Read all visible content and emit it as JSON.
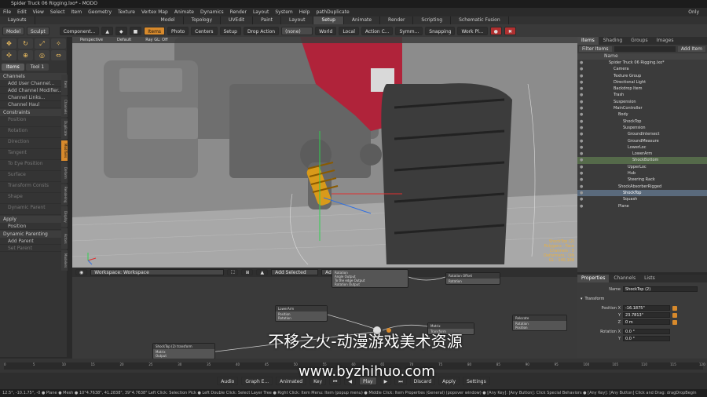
{
  "window": {
    "title": "Spider Truck 06 Rigging.lxo* - MODO"
  },
  "menu": [
    "File",
    "Edit",
    "View",
    "Select",
    "Item",
    "Geometry",
    "Texture",
    "Vertex Map",
    "Animate",
    "Dynamics",
    "Render",
    "Layout",
    "System",
    "Help",
    "pathDuplicate"
  ],
  "menu_right": "Only",
  "layouts": {
    "label": "Layouts",
    "tabs": [
      "Model",
      "Topology",
      "UVEdit",
      "Paint",
      "Layout",
      "Setup",
      "Animate",
      "Render",
      "Scripting",
      "Schematic Fusion"
    ],
    "active": "Setup"
  },
  "toolbar": {
    "items": [
      "Model",
      "Sculpt",
      "Component...",
      "Items",
      "Photo",
      "Centers",
      "Setup",
      "Drop Action",
      "(none)",
      "World",
      "Local",
      "Action C...",
      "Symm...",
      "Snapping",
      "Work Pl..."
    ]
  },
  "left": {
    "tabs": [
      "Items",
      "Tool 1"
    ],
    "channels_header": "Channels",
    "channel_items": [
      "Add User Channel...",
      "Add Channel Modifier...",
      "Channel Links...",
      "Channel Haul"
    ],
    "constraints_header": "Constraints",
    "constraint_items": [
      "Position",
      "Rotation",
      "Direction",
      "Tangent",
      "To Eye Position",
      "Surface",
      "Transform Consts",
      "Shape",
      "Dynamic Parent"
    ],
    "apply_label": "Apply",
    "position_label": "Position",
    "dynamic_header": "Dynamic Parenting",
    "add_parent": "Add Parent",
    "set_parent": "Set Parent",
    "vtabs": [
      "Item",
      "Channels",
      "Duplicate",
      "Modifiers",
      "Deform",
      "Rendering",
      "Display",
      "Actors",
      "Modelers"
    ]
  },
  "viewport": {
    "header": [
      "Perspective",
      "Default",
      "Ray GL: Off"
    ],
    "hud": [
      "ShockTop (2)",
      "Polygons : Face",
      "Channels : 5",
      "Deformers : ON",
      "GL : 140,188"
    ]
  },
  "schematic": {
    "workspace": "Workspace: Workspace",
    "add_selected": "Add Selected",
    "add": "Add ...",
    "nodes": [
      {
        "title": "",
        "rows": [
          "Rotation",
          "Angle Output",
          "To the edge Output",
          "Rotation Output"
        ]
      },
      {
        "title": "Rotation Offset",
        "rows": [
          "Rotation"
        ]
      },
      {
        "title": "LowerArm",
        "rows": [
          "Position",
          "Rotation"
        ]
      },
      {
        "title": "Matrix",
        "rows": [
          "Transform"
        ]
      },
      {
        "title": "ShockTop (2) transform",
        "rows": [
          "Matrix",
          "Output"
        ]
      },
      {
        "title": "Relocate",
        "rows": [
          "Rotation",
          "Position"
        ]
      }
    ]
  },
  "items": {
    "tabs": [
      "Items",
      "Shading",
      "Groups",
      "Images"
    ],
    "filter": "Filter Items",
    "add": "Add Item",
    "col": "Name",
    "tree": [
      {
        "n": "Spider Truck 06 Rigging.lxo*",
        "d": 0
      },
      {
        "n": "Camera",
        "d": 1
      },
      {
        "n": "Texture Group",
        "d": 1
      },
      {
        "n": "Directional Light",
        "d": 1
      },
      {
        "n": "Backdrop Item",
        "d": 1
      },
      {
        "n": "Trash",
        "d": 1
      },
      {
        "n": "Suspension",
        "d": 1
      },
      {
        "n": "MainController",
        "d": 1
      },
      {
        "n": "Body",
        "d": 2
      },
      {
        "n": "ShockTop",
        "d": 3
      },
      {
        "n": "Suspension",
        "d": 3
      },
      {
        "n": "GroundIntersect",
        "d": 4
      },
      {
        "n": "GroundMeasure",
        "d": 4
      },
      {
        "n": "LowerLoc",
        "d": 4
      },
      {
        "n": "LowerArm",
        "d": 5
      },
      {
        "n": "ShockBottom",
        "d": 5
      },
      {
        "n": "UpperLoc",
        "d": 4
      },
      {
        "n": "Hub",
        "d": 4
      },
      {
        "n": "Steering Rack",
        "d": 4
      },
      {
        "n": "ShockAbsorberRigged",
        "d": 2
      },
      {
        "n": "ShockTop",
        "d": 3
      },
      {
        "n": "Squash",
        "d": 3
      },
      {
        "n": "Plane",
        "d": 2
      }
    ],
    "selected_index": 20,
    "highlight_index": 15
  },
  "properties": {
    "tabs": [
      "Properties",
      "Channels",
      "Lists"
    ],
    "name_label": "Name",
    "name_value": "ShockTop (2)",
    "section": "Transform",
    "position_label": "Position X",
    "position": [
      "-16.1875\"",
      "23.7813\"",
      "0 m"
    ],
    "rotation_label": "Rotation X",
    "rotation": [
      "0.0 °",
      "0.0 °"
    ]
  },
  "timeline": {
    "ticks": [
      "0",
      "5",
      "10",
      "15",
      "20",
      "25",
      "30",
      "35",
      "40",
      "45",
      "50",
      "55",
      "60",
      "65",
      "70",
      "75",
      "80",
      "85",
      "90",
      "95",
      "100",
      "105",
      "110",
      "115",
      "120"
    ],
    "controls": [
      "Audio",
      "Graph E...",
      "Animated",
      "Key",
      "Play",
      "Discard",
      "Apply",
      "Settings"
    ]
  },
  "status": "12.5°, -10.1.75°, -0 ● Plane ● Mesh ● 10°4.7638\", 41.2838\", 39°4.7638\"     Left Click: Selection Pick ● Left Double Click: Select Layer Tree ● Right Click: Item Menu: Item (popup menu) ● Middle Click: Item Properties (General) (popover window) ● [Any Key]: [Any Button]: Click Special Behaviors ● [Any Key]: [Any Button] Click and Drag: dragDropBegin",
  "watermark": {
    "line1": "不移之火-动漫游戏美术资源",
    "line2": "www.byzhihuo.com"
  },
  "colors": {
    "accent": "#d88a2c",
    "selection": "#5a6a7c"
  }
}
